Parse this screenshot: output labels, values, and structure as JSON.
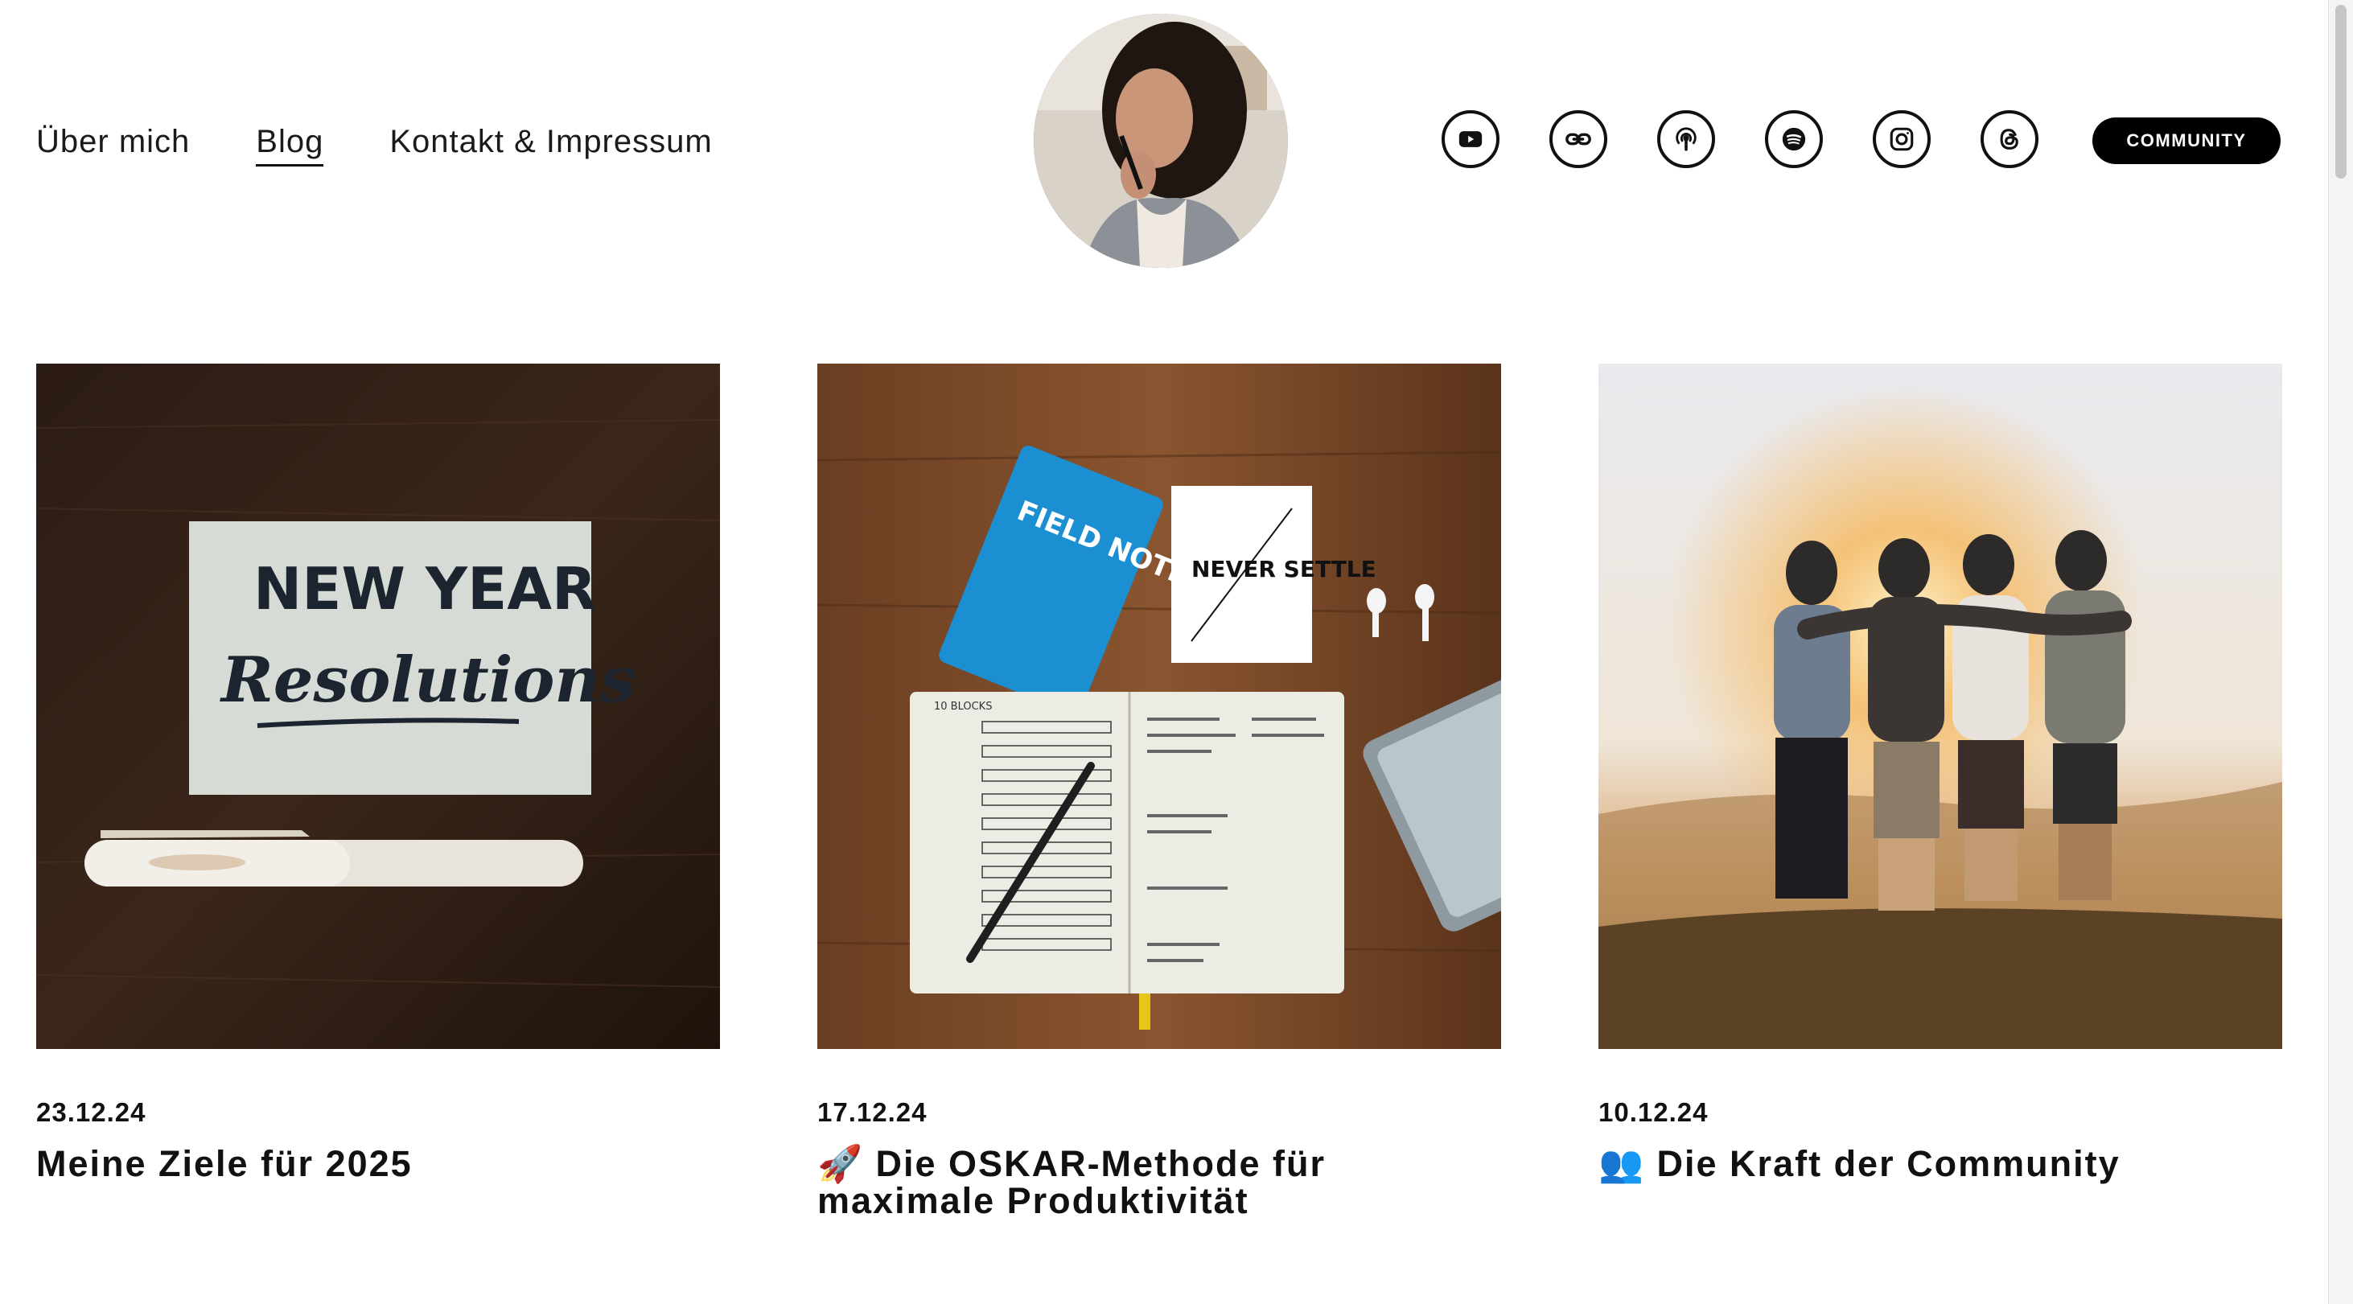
{
  "nav": [
    {
      "label": "Über mich",
      "active": false
    },
    {
      "label": "Blog",
      "active": true
    },
    {
      "label": "Kontakt & Impressum",
      "active": false
    }
  ],
  "social_icons": [
    "youtube-icon",
    "link-icon",
    "podcast-icon",
    "spotify-icon",
    "instagram-icon",
    "threads-icon"
  ],
  "community_button": "COMMUNITY",
  "image_texts": {
    "notebook_brand": "FIELD NOTES",
    "card": "NEVER SETTLE",
    "blocks": "10 BLOCKS"
  },
  "posts": [
    {
      "date": "23.12.24",
      "title": "Meine Ziele für 2025",
      "image_text": [
        "NEW YEAR",
        "Resolutions"
      ]
    },
    {
      "date": "17.12.24",
      "title": "🚀 Die OSKAR-Methode für maximale Produktivität"
    },
    {
      "date": "10.12.24",
      "title": "👥 Die Kraft der Community"
    }
  ]
}
